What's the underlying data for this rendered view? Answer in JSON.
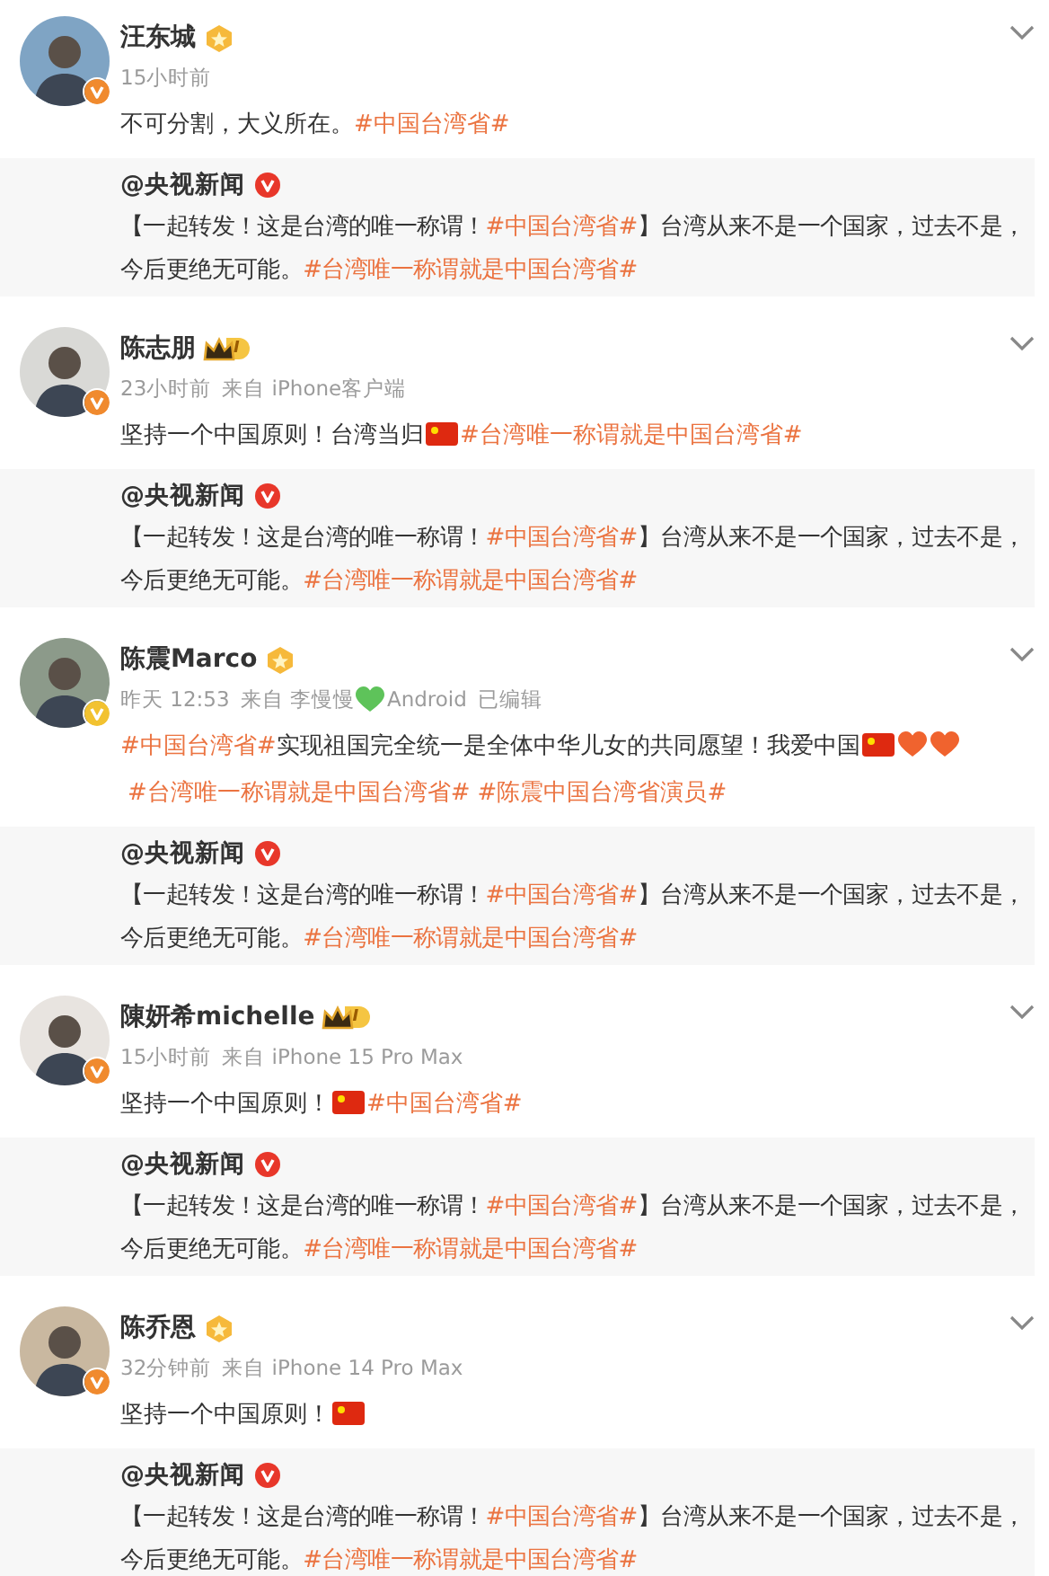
{
  "posts": [
    {
      "author": {
        "name": "汪东城",
        "verified": {
          "color": "#f08a2e"
        },
        "badge": {
          "kind": "medal"
        }
      },
      "meta": [
        {
          "kind": "time",
          "text": "15小时前"
        }
      ],
      "content": [
        {
          "kind": "text",
          "text": "不可分割，大义所在。"
        },
        {
          "kind": "tag",
          "text": "#中国台湾省#"
        }
      ],
      "repost": {
        "author": "@央视新闻",
        "verified": {
          "color": "#e8372a"
        },
        "content": [
          {
            "kind": "text",
            "text": "【一起转发！这是台湾的唯一称谓！"
          },
          {
            "kind": "tag",
            "text": "#中国台湾省#"
          },
          {
            "kind": "text",
            "text": "】台湾从来不是一个国家，过去不是，今后更绝无可能。"
          },
          {
            "kind": "tag",
            "text": "#台湾唯一称谓就是中国台湾省#"
          }
        ]
      }
    },
    {
      "author": {
        "name": "陈志朋",
        "verified": {
          "color": "#f08a2e"
        },
        "badge": {
          "kind": "vip",
          "tag_text": "I"
        }
      },
      "meta": [
        {
          "kind": "time",
          "text": "23小时前"
        },
        {
          "kind": "source",
          "text": "来自 iPhone客户端"
        }
      ],
      "content": [
        {
          "kind": "text",
          "text": "坚持一个中国原则！台湾当归"
        },
        {
          "kind": "flag"
        },
        {
          "kind": "tag",
          "text": "#台湾唯一称谓就是中国台湾省#"
        }
      ],
      "repost": {
        "author": "@央视新闻",
        "verified": {
          "color": "#e8372a"
        },
        "content": [
          {
            "kind": "text",
            "text": "【一起转发！这是台湾的唯一称谓！"
          },
          {
            "kind": "tag",
            "text": "#中国台湾省#"
          },
          {
            "kind": "text",
            "text": "】台湾从来不是一个国家，过去不是，今后更绝无可能。"
          },
          {
            "kind": "tag",
            "text": "#台湾唯一称谓就是中国台湾省#"
          }
        ]
      }
    },
    {
      "author": {
        "name": "陈震Marco",
        "verified": {
          "color": "#f2c230"
        },
        "badge": {
          "kind": "medal"
        }
      },
      "meta": [
        {
          "kind": "time",
          "text": "昨天 12:53"
        },
        {
          "kind": "source",
          "text": "来自 李慢慢"
        },
        {
          "kind": "heart",
          "color": "#5ec35a"
        },
        {
          "kind": "source",
          "text": "Android"
        },
        {
          "kind": "edited",
          "text": "已编辑"
        }
      ],
      "content": [
        {
          "kind": "tag",
          "text": "#中国台湾省#"
        },
        {
          "kind": "text",
          "text": "实现祖国完全统一是全体中华儿女的共同愿望！我爱中国"
        },
        {
          "kind": "flag"
        },
        {
          "kind": "heart",
          "color": "#f0632e"
        },
        {
          "kind": "heart",
          "color": "#f0632e"
        },
        {
          "kind": "tag",
          "text": "#台湾唯一称谓就是中国台湾省#"
        },
        {
          "kind": "tag",
          "text": "#陈震中国台湾省演员#"
        }
      ],
      "repost": {
        "author": "@央视新闻",
        "verified": {
          "color": "#e8372a"
        },
        "content": [
          {
            "kind": "text",
            "text": "【一起转发！这是台湾的唯一称谓！"
          },
          {
            "kind": "tag",
            "text": "#中国台湾省#"
          },
          {
            "kind": "text",
            "text": "】台湾从来不是一个国家，过去不是，今后更绝无可能。"
          },
          {
            "kind": "tag",
            "text": "#台湾唯一称谓就是中国台湾省#"
          }
        ]
      }
    },
    {
      "author": {
        "name": "陳妍希michelle",
        "verified": {
          "color": "#f08a2e"
        },
        "badge": {
          "kind": "vip",
          "tag_text": "I"
        }
      },
      "meta": [
        {
          "kind": "time",
          "text": "15小时前"
        },
        {
          "kind": "source",
          "text": "来自 iPhone 15 Pro Max"
        }
      ],
      "content": [
        {
          "kind": "text",
          "text": "坚持一个中国原则！"
        },
        {
          "kind": "flag"
        },
        {
          "kind": "tag",
          "text": "#中国台湾省#"
        }
      ],
      "repost": {
        "author": "@央视新闻",
        "verified": {
          "color": "#e8372a"
        },
        "content": [
          {
            "kind": "text",
            "text": "【一起转发！这是台湾的唯一称谓！"
          },
          {
            "kind": "tag",
            "text": "#中国台湾省#"
          },
          {
            "kind": "text",
            "text": "】台湾从来不是一个国家，过去不是，今后更绝无可能。"
          },
          {
            "kind": "tag",
            "text": "#台湾唯一称谓就是中国台湾省#"
          }
        ]
      }
    },
    {
      "author": {
        "name": "陈乔恩",
        "verified": {
          "color": "#f08a2e"
        },
        "badge": {
          "kind": "medal"
        }
      },
      "meta": [
        {
          "kind": "time",
          "text": "32分钟前"
        },
        {
          "kind": "source",
          "text": "来自 iPhone 14 Pro Max"
        }
      ],
      "content": [
        {
          "kind": "text",
          "text": "坚持一个中国原则！"
        },
        {
          "kind": "flag"
        }
      ],
      "repost": {
        "author": "@央视新闻",
        "verified": {
          "color": "#e8372a"
        },
        "content": [
          {
            "kind": "text",
            "text": "【一起转发！这是台湾的唯一称谓！"
          },
          {
            "kind": "tag",
            "text": "#中国台湾省#"
          },
          {
            "kind": "text",
            "text": "】台湾从来不是一个国家，过去不是，今后更绝无可能。"
          },
          {
            "kind": "tag",
            "text": "#台湾唯一称谓就是中国台湾省#"
          }
        ]
      }
    }
  ]
}
